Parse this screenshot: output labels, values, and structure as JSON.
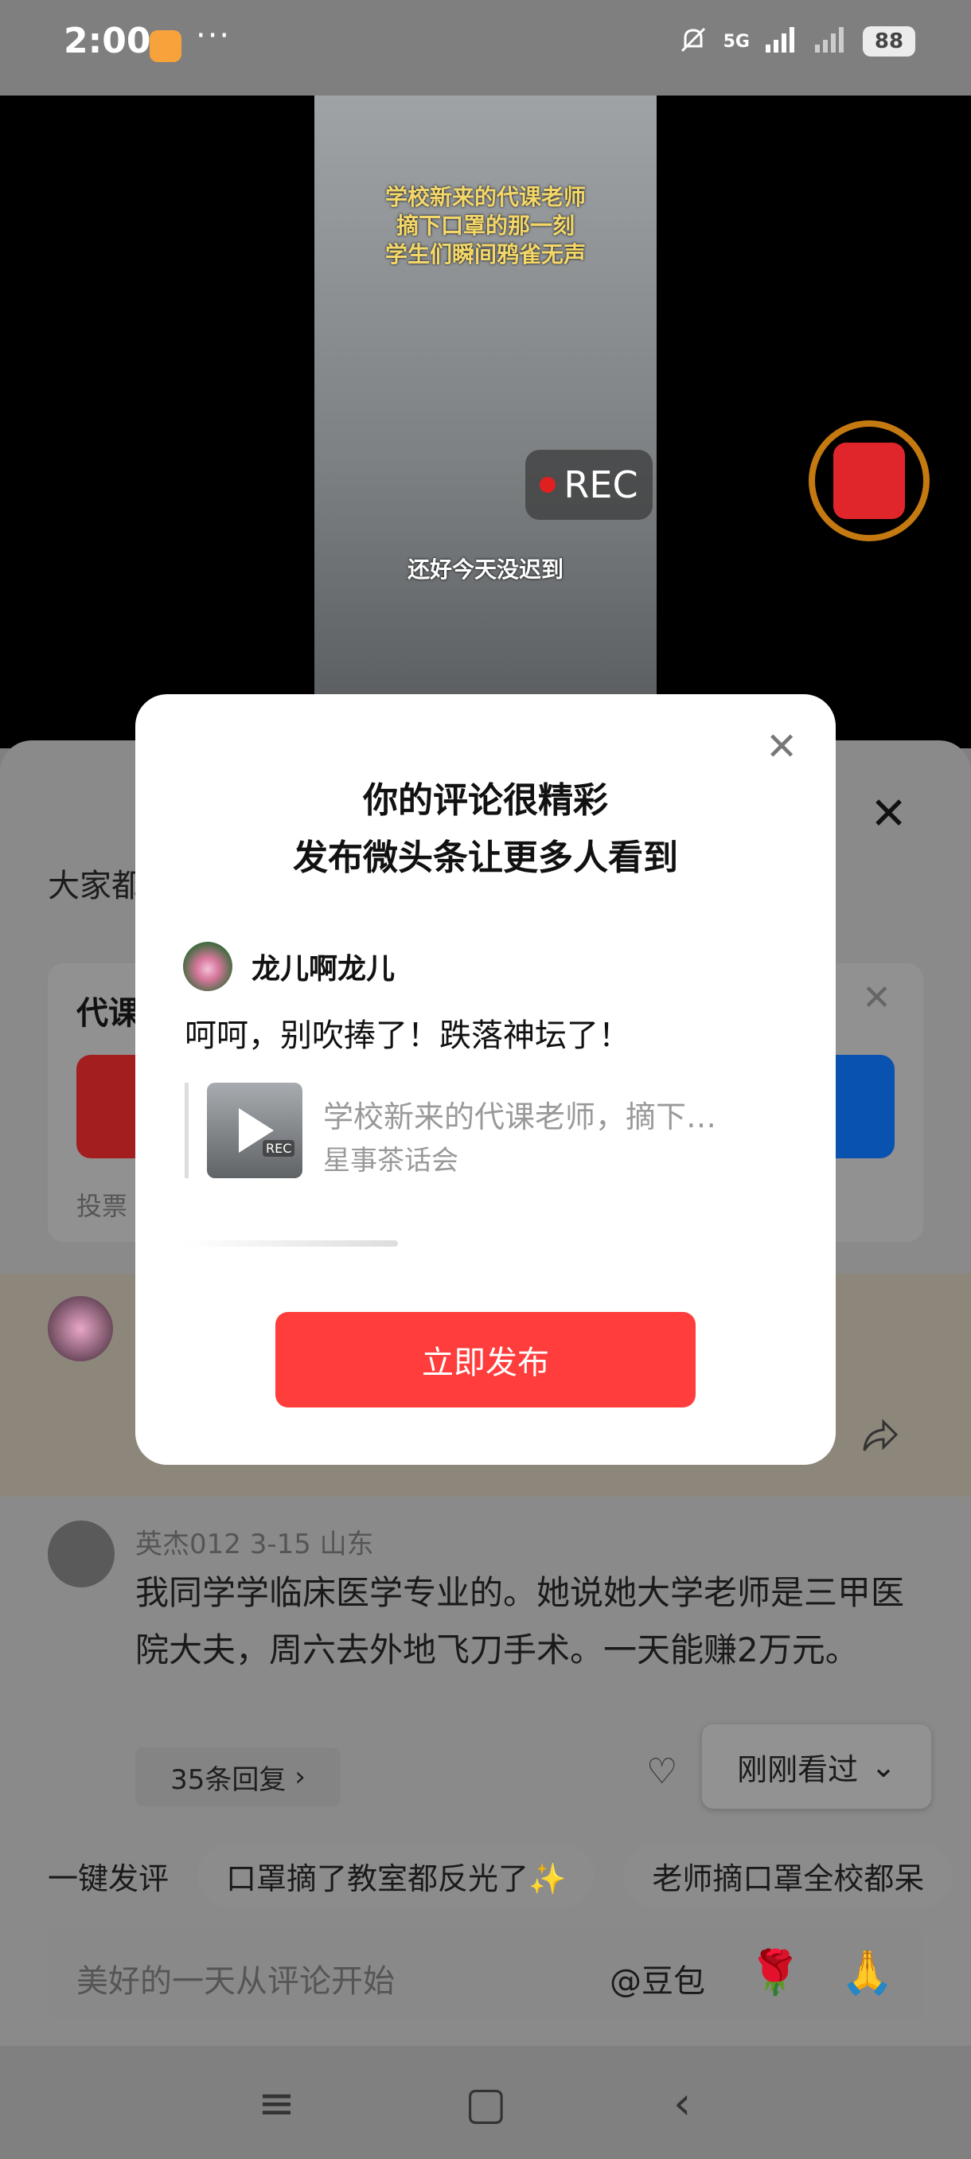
{
  "status_bar": {
    "time": "2:00",
    "more": "···",
    "network": "5G",
    "battery": "88"
  },
  "video": {
    "caption_lines": [
      "学校新来的代课老师",
      "摘下口罩的那一刻",
      "学生们瞬间鸦雀无声"
    ],
    "subtitle": "还好今天没迟到",
    "rec_label": "REC"
  },
  "sheet": {
    "title_partial": "大家都",
    "close": "✕",
    "poll_question_partial": "代课",
    "poll_label_partial": "投票"
  },
  "comment2": {
    "meta": "英杰012  3-15  山东",
    "text": "我同学学临床医学专业的。她说她大学老师是三甲医院大夫，周六去外地飞刀手术。一天能赚2万元。",
    "replies": "35条回复",
    "recent": "刚刚看过"
  },
  "quick": {
    "label": "一键发评",
    "chips": [
      "口罩摘了教室都反光了✨",
      "老师摘口罩全校都呆"
    ]
  },
  "input": {
    "placeholder": "美好的一天从评论开始",
    "mention": "@豆包",
    "emoji1": "🌹",
    "emoji2": "🙏"
  },
  "modal": {
    "title_line1": "你的评论很精彩",
    "title_line2": "发布微头条让更多人看到",
    "username": "龙儿啊龙儿",
    "comment": "呵呵，别吹捧了！跌落神坛了！",
    "quote_title": "学校新来的代课老师，摘下…",
    "quote_source": "星事茶话会",
    "thumb_rec": "REC",
    "button": "立即发布",
    "close": "✕"
  },
  "colors": {
    "accent_red": "#fe3d3c",
    "overlay_gray": "#808080"
  }
}
